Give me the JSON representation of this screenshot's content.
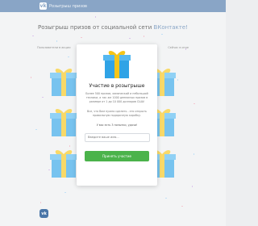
{
  "header": {
    "logo_icon": "vk-logo-icon",
    "logo_letter": "vk",
    "site_name": "Розыгрыш призов",
    "bg_color": "#4a76a8"
  },
  "page": {
    "title": "Розыгрыш призов от социальной сети",
    "title_accent": "ВКонтакте!",
    "subbar_left": "Пользователи в акции",
    "subbar_right": "Сейчас в игре",
    "bg_color": "#edeef0"
  },
  "modal": {
    "gift_icon": "gift-box-icon",
    "title": "Участие в розыгрыше",
    "text_1": "Более 500 призов, химический и небольшой техники, а так же 1000 денежных призов в размере от 1 до 10 000 долларов США!",
    "text_2": "Все, что Вам нужно сделать - это открыть правильную подарочную коробку.",
    "text_3": "У вас есть 3 попытки, удачи!",
    "input_placeholder": "Введите ваше имя...",
    "button_label": "Принять участие",
    "button_color": "#4bb34b"
  },
  "footer": {
    "app_icon": "vk-app-icon",
    "app_letter": "vk"
  }
}
